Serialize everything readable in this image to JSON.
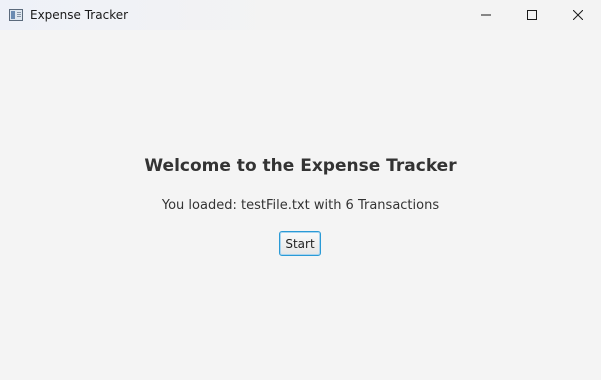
{
  "window": {
    "title": "Expense Tracker",
    "controls": {
      "minimize_icon": "minimize-icon",
      "maximize_icon": "maximize-icon",
      "close_icon": "close-icon"
    }
  },
  "main": {
    "heading": "Welcome to the Expense Tracker",
    "loaded_message": "You loaded: testFile.txt with 6 Transactions",
    "start_label": "Start"
  },
  "colors": {
    "background": "#f4f4f4",
    "text": "#333333",
    "button_focus_border": "#2a9ad6"
  }
}
